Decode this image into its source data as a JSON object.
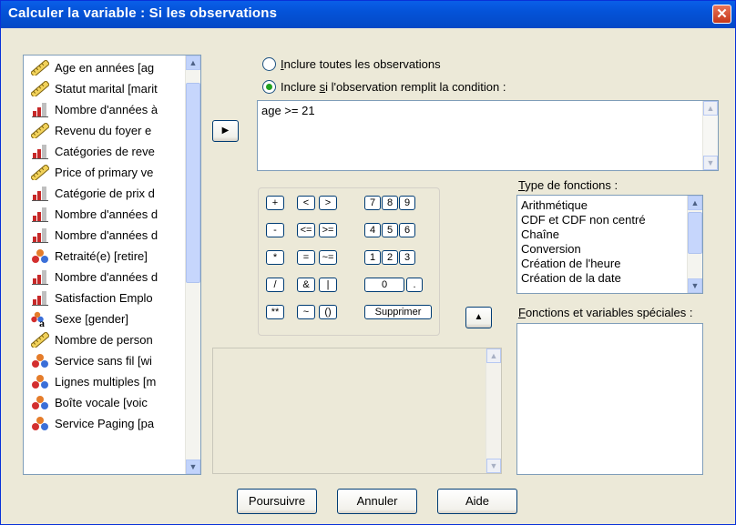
{
  "window": {
    "title": "Calculer la variable : Si les observations",
    "close_glyph": "✕"
  },
  "variables": [
    {
      "label": "Age en années [ag",
      "icon": "scale-icon"
    },
    {
      "label": "Statut marital [marit",
      "icon": "scale-icon"
    },
    {
      "label": "Nombre d'années à",
      "icon": "ordinal-icon"
    },
    {
      "label": "Revenu du foyer e",
      "icon": "scale-icon"
    },
    {
      "label": "Catégories de reve",
      "icon": "ordinal-icon"
    },
    {
      "label": "Price of primary ve",
      "icon": "scale-icon"
    },
    {
      "label": "Catégorie de prix d",
      "icon": "ordinal-icon"
    },
    {
      "label": "Nombre d'années d",
      "icon": "ordinal-icon"
    },
    {
      "label": "Nombre d'années d",
      "icon": "ordinal-icon"
    },
    {
      "label": "Retraité(e) [retire]",
      "icon": "nominal-icon"
    },
    {
      "label": "Nombre d'années d",
      "icon": "ordinal-icon"
    },
    {
      "label": "Satisfaction Emplo",
      "icon": "ordinal-icon"
    },
    {
      "label": "Sexe [gender]",
      "icon": "string-icon"
    },
    {
      "label": "Nombre de person",
      "icon": "scale-icon"
    },
    {
      "label": "Service sans fil [wi",
      "icon": "nominal-icon"
    },
    {
      "label": "Lignes multiples [m",
      "icon": "nominal-icon"
    },
    {
      "label": "Boîte vocale [voic",
      "icon": "nominal-icon"
    },
    {
      "label": "Service Paging [pa",
      "icon": "nominal-icon"
    }
  ],
  "options": {
    "all_mnemonic": "I",
    "all_rest": "nclure toutes les observations",
    "cond_prefix": "Inclure ",
    "cond_mnemonic": "s",
    "cond_rest": "i l'observation remplit la condition :",
    "selected": "condition"
  },
  "condition_expression": "age  >= 21",
  "arrow_right": "▶",
  "arrow_up": "▲",
  "keypad": {
    "plus": "+",
    "lt": "<",
    "gt": ">",
    "d7": "7",
    "d8": "8",
    "d9": "9",
    "minus": "-",
    "le": "<=",
    "ge": ">=",
    "d4": "4",
    "d5": "5",
    "d6": "6",
    "mult": "*",
    "eq": "=",
    "ne": "~=",
    "d1": "1",
    "d2": "2",
    "d3": "3",
    "div": "/",
    "and": "&",
    "or": "|",
    "d0": "0",
    "dot": ".",
    "pow": "**",
    "not": "~",
    "paren": "()",
    "delete": "Supprimer"
  },
  "function_group": {
    "label_prefix": "",
    "label_mnemonic": "T",
    "label_rest": "ype de fonctions  :",
    "items": [
      "Arithmétique",
      "CDF et CDF non centré",
      "Chaîne",
      "Conversion",
      "Création de l'heure",
      "Création de la date"
    ]
  },
  "special_functions": {
    "label_mnemonic": "F",
    "label_rest": "onctions et variables spéciales :"
  },
  "buttons": {
    "continue": "Poursuivre",
    "cancel": "Annuler",
    "help": "Aide"
  },
  "scroll_glyphs": {
    "up": "▲",
    "down": "▼"
  }
}
